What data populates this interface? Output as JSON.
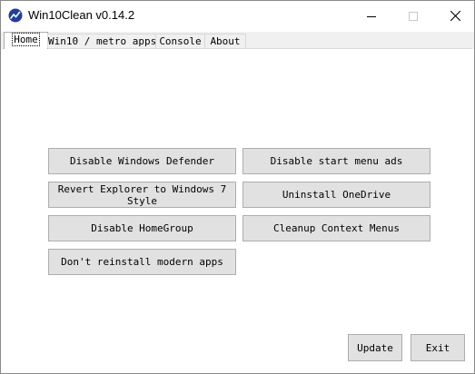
{
  "window": {
    "title": "Win10Clean v0.14.2",
    "icons": {
      "app": "win10clean-app-icon",
      "minimize": "minimize-icon",
      "maximize": "maximize-icon",
      "close": "close-icon"
    }
  },
  "tabs": [
    {
      "label": "Home",
      "active": true
    },
    {
      "label": "Win10 / metro apps"
    },
    {
      "label": "Console"
    },
    {
      "label": "About"
    }
  ],
  "home": {
    "buttons": {
      "disable_defender": "Disable Windows Defender",
      "disable_start_ads": "Disable start menu ads",
      "revert_explorer": "Revert Explorer to Windows 7 Style",
      "uninstall_onedrive": "Uninstall OneDrive",
      "disable_homegroup": "Disable HomeGroup",
      "cleanup_context": "Cleanup Context Menus",
      "dont_reinstall": "Don't reinstall modern apps"
    }
  },
  "footer": {
    "update_label": "Update",
    "exit_label": "Exit"
  },
  "colors": {
    "accent": "#1e3fa0",
    "button_bg": "#e1e1e1",
    "button_border": "#adadad"
  }
}
